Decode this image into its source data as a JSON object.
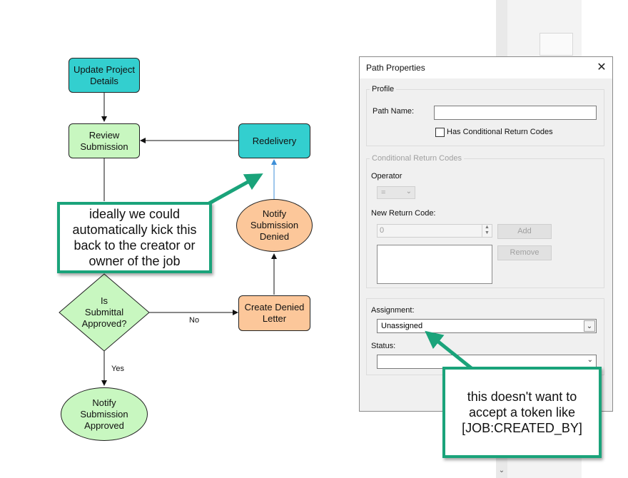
{
  "flowchart": {
    "nodes": {
      "update_project": "Update Project Details",
      "review_submission": "Review Submission",
      "redelivery": "Redelivery",
      "notify_denied": "Notify Submission Denied",
      "is_approved": "Is Submittal Approved?",
      "create_denied_letter": "Create Denied Letter",
      "notify_approved": "Notify Submission Approved"
    },
    "edge_labels": {
      "no": "No",
      "yes": "Yes"
    }
  },
  "callouts": {
    "left": "ideally we could automatically kick this back to the creator or owner of the job",
    "right": "this doesn't want to accept a token like [JOB:CREATED_BY]"
  },
  "dialog": {
    "title": "Path Properties",
    "close": "✕",
    "profile": {
      "group_label": "Profile",
      "path_name_label": "Path Name:",
      "path_name_value": "",
      "has_conditional_label": "Has Conditional Return Codes",
      "has_conditional_checked": false
    },
    "conditional": {
      "group_label": "Conditional Return Codes",
      "operator_label": "Operator",
      "operator_value": "=",
      "new_return_code_label": "New Return Code:",
      "new_return_code_value": "0",
      "add_label": "Add",
      "remove_label": "Remove"
    },
    "assignment": {
      "assignment_label": "Assignment:",
      "assignment_value": "Unassigned",
      "status_label": "Status:",
      "status_value": ""
    }
  },
  "colors": {
    "teal": "#33cfcf",
    "green": "#c8f7c0",
    "orange": "#fcc79a",
    "callout_border": "#1aa37a",
    "arrow_blue": "#3d8fd8"
  }
}
